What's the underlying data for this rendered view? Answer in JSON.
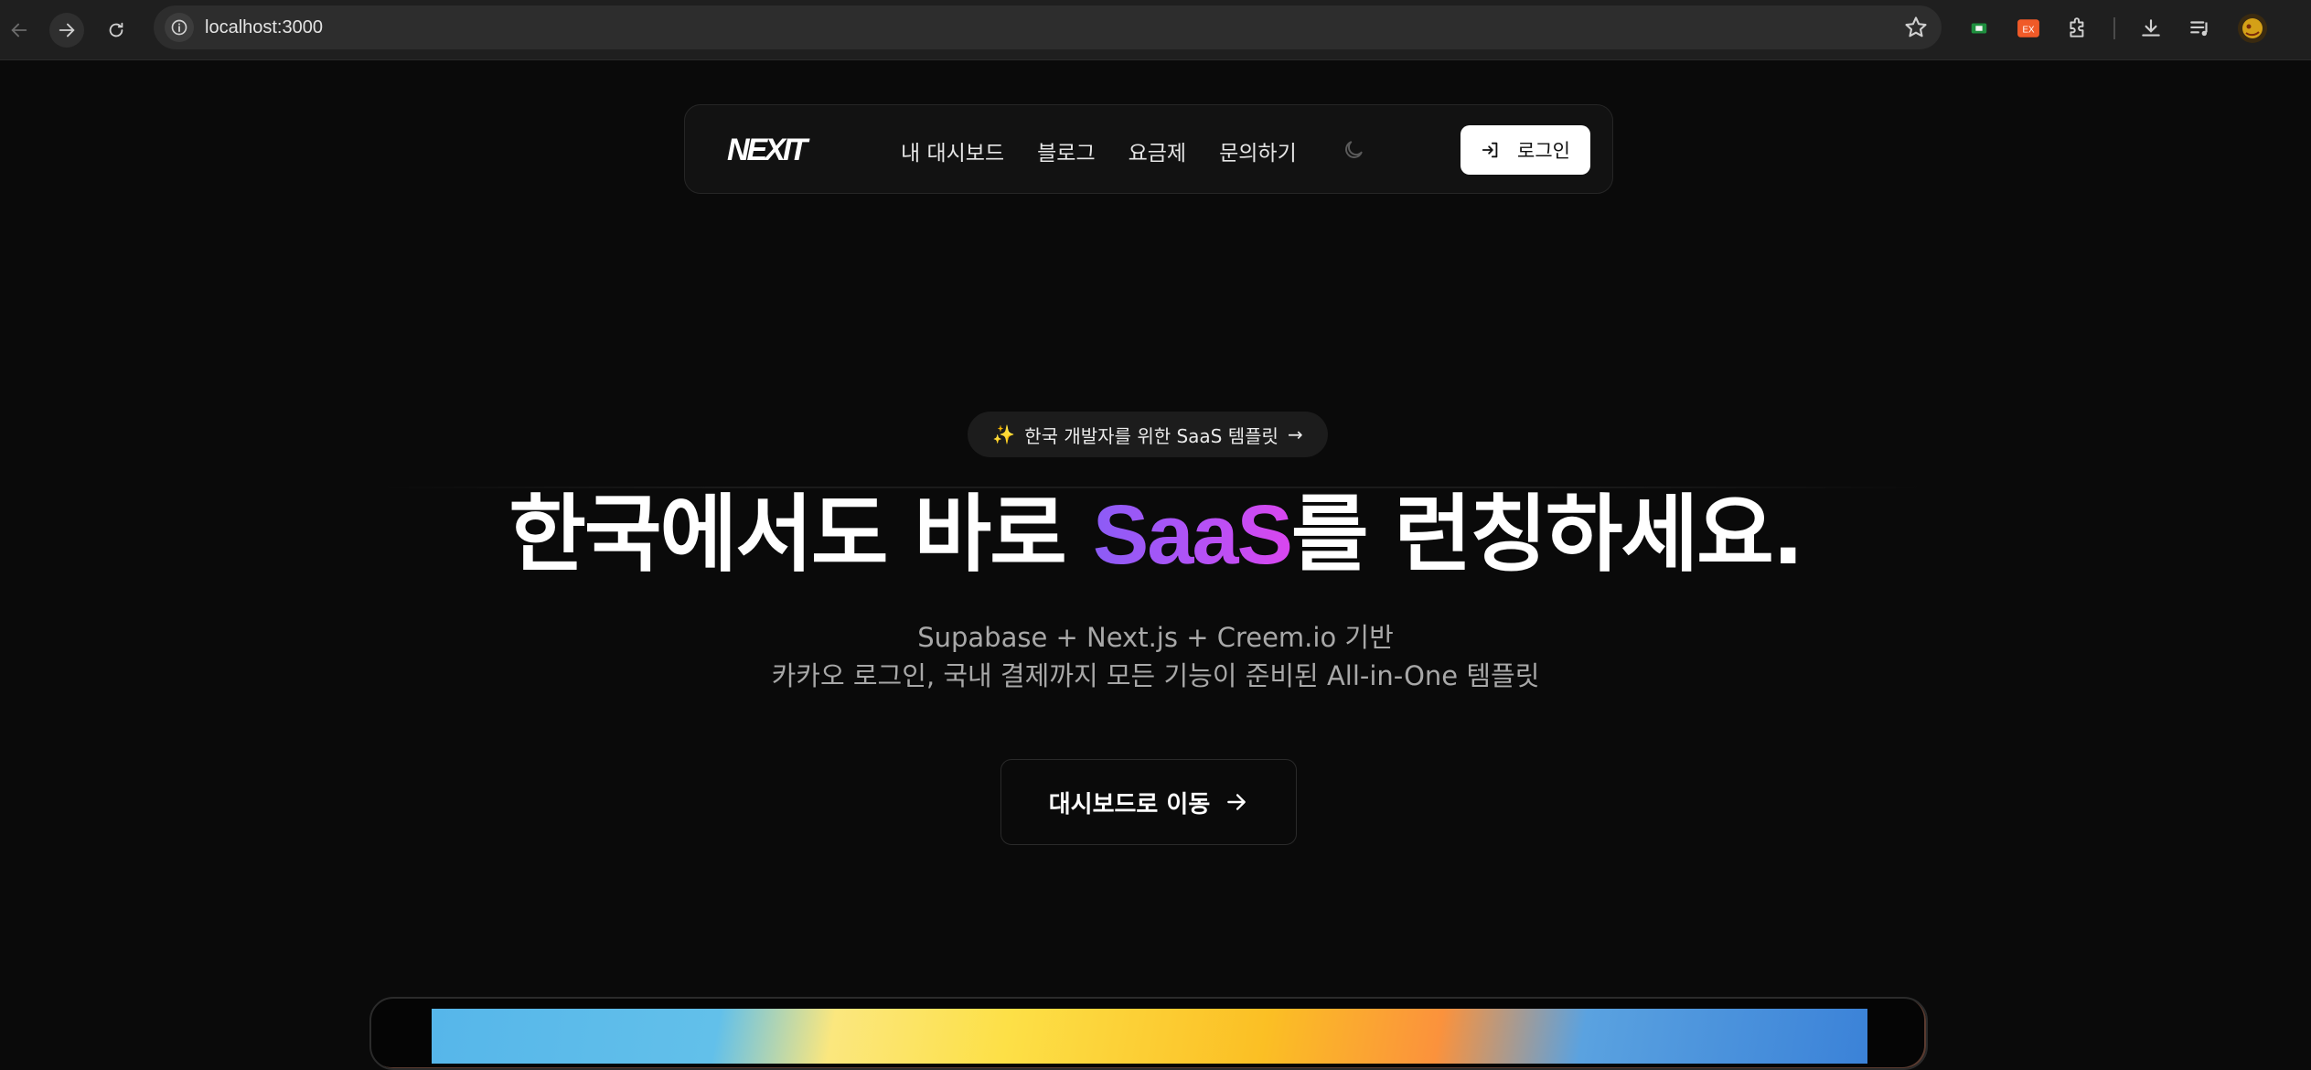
{
  "browser": {
    "url": "localhost:3000",
    "back_icon": "arrow-left-icon",
    "forward_icon": "arrow-right-icon",
    "reload_icon": "reload-icon",
    "site_info_icon": "info-icon",
    "bookmark_icon": "star-icon",
    "extensions": [
      {
        "name": "green-extension-icon",
        "color": "#1e8e3e"
      },
      {
        "name": "ex-extension-icon",
        "label": "EX",
        "color": "#f05a28"
      },
      {
        "name": "puzzle-extensions-icon"
      },
      {
        "name": "download-icon"
      },
      {
        "name": "media-queue-icon"
      },
      {
        "name": "profile-avatar-icon",
        "color": "#d4a017"
      }
    ]
  },
  "nav": {
    "logo": "NEXIT",
    "menu": [
      "내 대시보드",
      "블로그",
      "요금제",
      "문의하기"
    ],
    "theme_icon": "moon-icon",
    "login_label": "로그인",
    "login_icon": "log-in-icon"
  },
  "hero": {
    "badge_spark": "✨",
    "badge_text": "한국 개발자를 위한 SaaS 템플릿",
    "badge_arrow": "→",
    "headline_part1": "한국에서도 바로 ",
    "headline_saas": "SaaS",
    "headline_part2": "를 ",
    "headline_bold": "런칭",
    "headline_part3": "하세요.",
    "subtitle_line1": "Supabase + Next.js + Creem.io 기반",
    "subtitle_line2": "카카오 로그인, 국내 결제까지 모든 기능이 준비된 All-in-One 템플릿",
    "cta_label": "대시보드로 이동",
    "cta_icon": "arrow-right-icon"
  },
  "colors": {
    "background": "#0a0a0a",
    "saas_gradient_start": "#8b5cf6",
    "saas_gradient_end": "#d946ef"
  }
}
